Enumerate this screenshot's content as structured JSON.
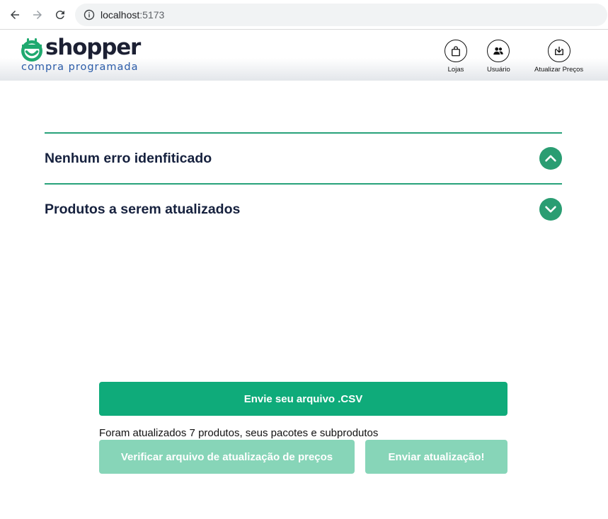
{
  "browser": {
    "url_host": "localhost",
    "url_port": ":5173"
  },
  "header": {
    "logo_word": "shopper",
    "logo_tagline": "compra programada",
    "actions": [
      {
        "label": "Lojas",
        "icon": "shopping-bag-icon"
      },
      {
        "label": "Usuário",
        "icon": "users-icon"
      },
      {
        "label": "Atualizar Preços",
        "icon": "download-box-icon"
      }
    ]
  },
  "accordion": {
    "items": [
      {
        "title": "Nenhum erro idenfiticado",
        "state": "expanded",
        "icon": "chevron-up-icon"
      },
      {
        "title": "Produtos a serem atualizados",
        "state": "collapsed",
        "icon": "chevron-down-icon"
      }
    ]
  },
  "upload": {
    "button_label": "Envie seu arquivo .CSV",
    "status_message": "Foram atualizados 7 produtos, seus pacotes e subprodutos",
    "verify_label": "Verificar arquivo de atualização de preços",
    "send_label": "Enviar atualização!"
  },
  "colors": {
    "primary_green": "#0fab7a",
    "disabled_green": "#87d5b8",
    "accordion_border": "#27a27a",
    "toggle_green": "#2a9d72",
    "logo_blue": "#2a5ba8",
    "text_dark": "#16213e"
  }
}
